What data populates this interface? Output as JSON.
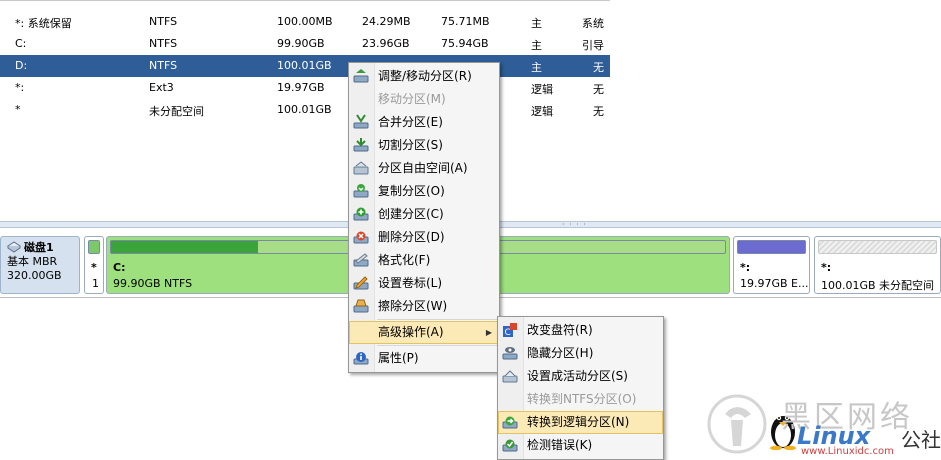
{
  "partition_table": {
    "rows": [
      {
        "name": "*: 系统保留",
        "fs": "NTFS",
        "capacity": "100.00MB",
        "used": "24.29MB",
        "free": "75.71MB",
        "type": "主",
        "status": "系统",
        "selected": false
      },
      {
        "name": "C:",
        "fs": "NTFS",
        "capacity": "99.90GB",
        "used": "23.96GB",
        "free": "75.94GB",
        "type": "主",
        "status": "引导",
        "selected": false
      },
      {
        "name": "D:",
        "fs": "NTFS",
        "capacity": "100.01GB",
        "used": "",
        "free": "",
        "type": "主",
        "status": "无",
        "selected": true
      },
      {
        "name": "*:",
        "fs": "Ext3",
        "capacity": "19.97GB",
        "used": "",
        "free": "",
        "type": "逻辑",
        "status": "无",
        "selected": false
      },
      {
        "name": "*",
        "fs": "未分配空间",
        "capacity": "100.01GB",
        "used": "",
        "free": "",
        "type": "逻辑",
        "status": "无",
        "selected": false
      }
    ]
  },
  "disk_map": {
    "disk": {
      "title": "磁盘1",
      "kind": "基本 MBR",
      "size": "320.00GB"
    },
    "partitions": [
      {
        "id": "sysres",
        "label": "*",
        "info": "1",
        "fill": 1.0,
        "color": "#7cc96a"
      },
      {
        "id": "c",
        "label": "C:",
        "info": "99.90GB NTFS",
        "fill": 0.24,
        "color": "#3aa33a"
      },
      {
        "id": "ext3",
        "label": "*:",
        "info": "19.97GB E...",
        "fill": 1.0,
        "color": "#6b6bd0"
      },
      {
        "id": "unalloc",
        "label": "*:",
        "info": "100.01GB 未分配空间",
        "fill": 0.0,
        "color": "#e6e6e6"
      }
    ]
  },
  "context_menu": {
    "items": [
      {
        "label": "调整/移动分区(R)",
        "icon": "resize-move-icon",
        "enabled": true
      },
      {
        "label": "移动分区(M)",
        "icon": "",
        "enabled": false
      },
      {
        "label": "合并分区(E)",
        "icon": "merge-icon",
        "enabled": true
      },
      {
        "label": "切割分区(S)",
        "icon": "split-icon",
        "enabled": true
      },
      {
        "label": "分区自由空间(A)",
        "icon": "allocate-space-icon",
        "enabled": true
      },
      {
        "label": "复制分区(O)",
        "icon": "copy-partition-icon",
        "enabled": true
      },
      {
        "label": "创建分区(C)",
        "icon": "create-partition-icon",
        "enabled": true
      },
      {
        "label": "删除分区(D)",
        "icon": "delete-partition-icon",
        "enabled": true
      },
      {
        "label": "格式化(F)",
        "icon": "format-icon",
        "enabled": true
      },
      {
        "label": "设置卷标(L)",
        "icon": "label-icon",
        "enabled": true
      },
      {
        "label": "擦除分区(W)",
        "icon": "wipe-icon",
        "enabled": true
      },
      {
        "label": "高级操作(A)",
        "icon": "",
        "enabled": true,
        "submenu": true
      },
      {
        "label": "属性(P)",
        "icon": "info-icon",
        "enabled": true
      }
    ]
  },
  "submenu": {
    "items": [
      {
        "label": "改变盘符(R)",
        "icon": "change-letter-icon",
        "enabled": true
      },
      {
        "label": "隐藏分区(H)",
        "icon": "hide-partition-icon",
        "enabled": true
      },
      {
        "label": "设置成活动分区(S)",
        "icon": "set-active-icon",
        "enabled": true
      },
      {
        "label": "转换到NTFS分区(O)",
        "icon": "",
        "enabled": false
      },
      {
        "label": "转换到逻辑分区(N)",
        "icon": "convert-logical-icon",
        "enabled": true,
        "highlighted": true
      },
      {
        "label": "检测错误(K)",
        "icon": "check-error-icon",
        "enabled": true
      }
    ]
  },
  "watermark": {
    "cn": "黑区网络",
    "brand": "Linux",
    "suffix": "公社",
    "site": "www.Linuxidc.com"
  }
}
